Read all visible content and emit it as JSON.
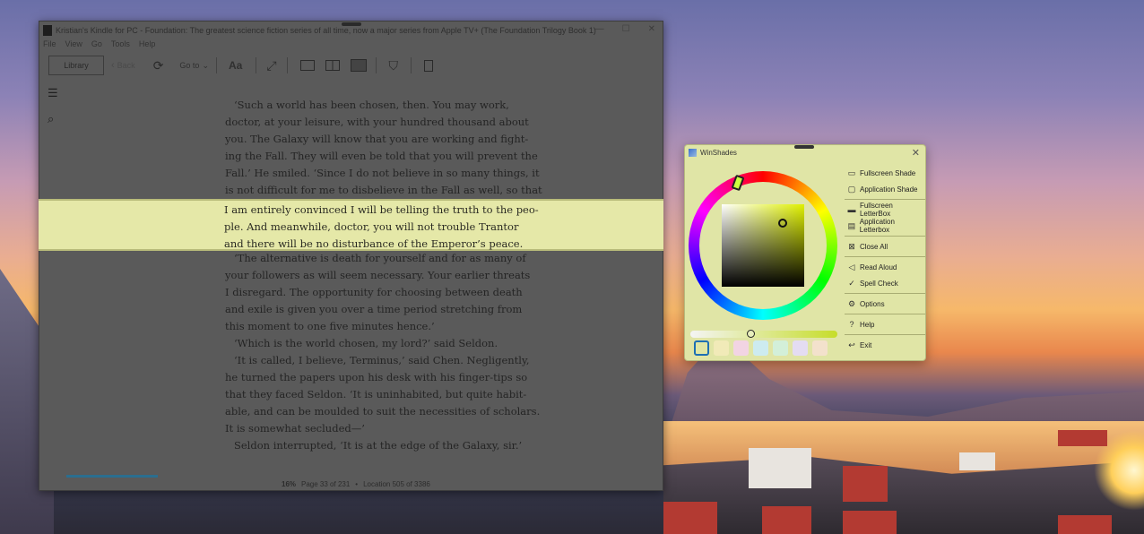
{
  "kindle": {
    "title": "Kristian's Kindle for PC - Foundation: The greatest science fiction series of all time, now a major series from Apple TV+ (The Foundation Trilogy Book 1)",
    "win_min": "—",
    "win_max": "☐",
    "win_close": "✕",
    "menu": [
      "File",
      "View",
      "Go",
      "Tools",
      "Help"
    ],
    "toolbar": {
      "library": "Library",
      "back": "Back",
      "goto": "Go to",
      "font": "Aa"
    },
    "page_lines": [
      "‘Such a world has been chosen, then. You may work,",
      "doctor, at your leisure, with your hundred thousand about",
      "you. The Galaxy will know that you are working and fight-",
      "ing the Fall. They will even be told that you will prevent the",
      "Fall.’ He smiled. ‘Since I do not believe in so many things, it",
      "is not difficult for me to disbelieve in the Fall as well, so that",
      "I am entirely convinced I will be telling the truth to the peo-",
      "ple. And meanwhile, doctor, you will not trouble Trantor",
      "and there will be no disturbance of the Emperor’s peace.",
      "‘The alternative is death for yourself and for as many of",
      "your followers as will seem necessary. Your earlier threats",
      "I disregard. The opportunity for choosing between death",
      "and exile is given you over a time period stretching from",
      "this moment to one five minutes hence.’",
      "‘Which is the world chosen, my lord?’ said Seldon.",
      "‘It is called, I believe, Terminus,’ said Chen. Negligently,",
      "he turned the papers upon his desk with his finger-tips so",
      "that they faced Seldon. ‘It is uninhabited, but quite habit-",
      "able, and can be moulded to suit the necessities of scholars.",
      "It is somewhat secluded—’",
      "Seldon interrupted, ‘It is at the edge of the Galaxy, sir.’"
    ],
    "status": {
      "percent": "16%",
      "page": "Page 33 of 231",
      "dot": "•",
      "location": "Location 505 of 3386"
    },
    "progress_fraction": 0.16
  },
  "winshades": {
    "title": "WinShades",
    "close": "✕",
    "menu": [
      {
        "label": "Fullscreen Shade",
        "icon": "monitor-icon"
      },
      {
        "label": "Application Shade",
        "icon": "window-icon"
      },
      {
        "label": "Fullscreen LetterBox",
        "icon": "letterbox-icon"
      },
      {
        "label": "Application Letterbox",
        "icon": "app-letterbox-icon"
      },
      {
        "label": "Close All",
        "icon": "close-all-icon"
      },
      {
        "label": "Read Aloud",
        "icon": "speaker-icon"
      },
      {
        "label": "Spell Check",
        "icon": "spellcheck-icon"
      },
      {
        "label": "Options",
        "icon": "gear-icon"
      },
      {
        "label": "Help",
        "icon": "help-icon"
      },
      {
        "label": "Exit",
        "icon": "exit-icon"
      }
    ],
    "swatches": [
      "#dfe6a4",
      "#f1eab8",
      "#f2d4e3",
      "#cdebf0",
      "#d3efd9",
      "#e4dcf2",
      "#f3e1cc"
    ]
  }
}
